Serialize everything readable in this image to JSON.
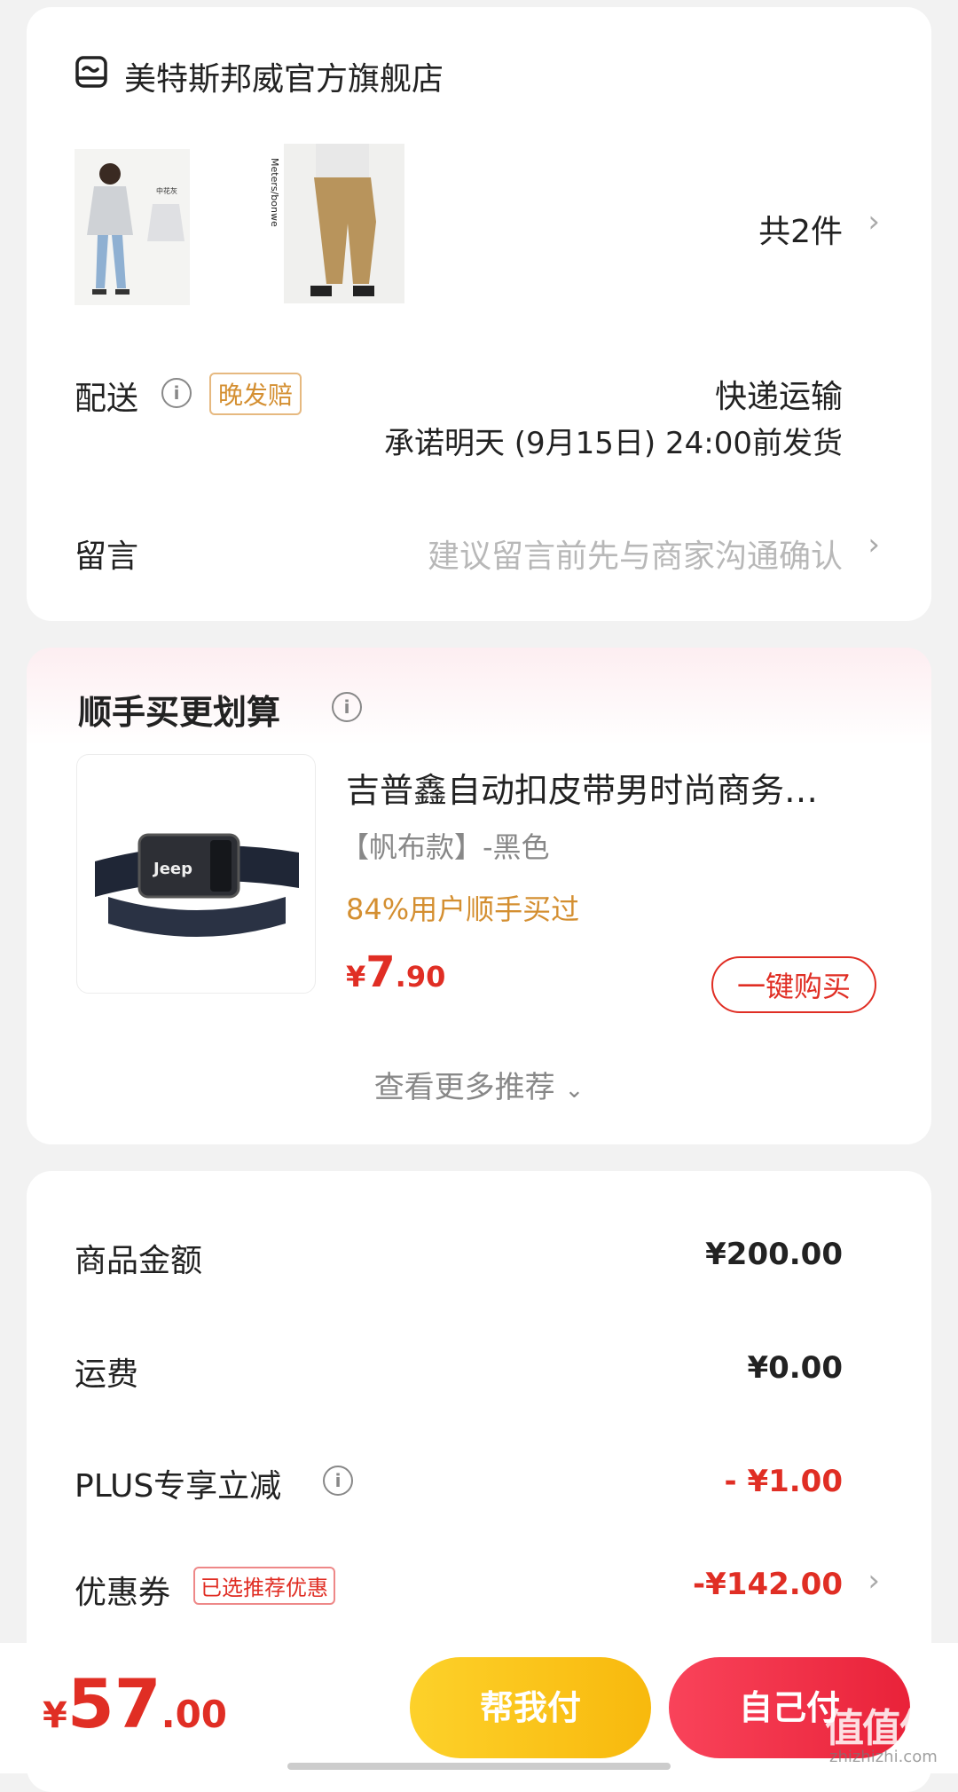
{
  "store": {
    "name": "美特斯邦威官方旗舰店",
    "icon": "store-icon"
  },
  "products": {
    "count_label": "共2件"
  },
  "delivery": {
    "label": "配送",
    "tag": "晚发赔",
    "method": "快递运输",
    "promise": "承诺明天 (9月15日) 24:00前发货"
  },
  "message": {
    "label": "留言",
    "placeholder": "建议留言前先与商家沟通确认"
  },
  "recommend": {
    "title": "顺手买更划算",
    "item": {
      "name": "吉普鑫自动扣皮带男时尚商务…",
      "variant": "【帆布款】-黑色",
      "stat": "84%用户顺手买过",
      "currency": "¥",
      "price_int": "7",
      "price_dec": ".90",
      "buy_label": "一键购买",
      "image_brand": "Jeep"
    },
    "more_label": "查看更多推荐"
  },
  "summary": {
    "rows": [
      {
        "label": "商品金额",
        "value": "¥200.00"
      },
      {
        "label": "运费",
        "value": "¥0.00"
      },
      {
        "label": "PLUS专享立减",
        "value": "- ¥1.00"
      },
      {
        "label": "优惠券",
        "tag": "已选推荐优惠",
        "value": "-¥142.00"
      }
    ]
  },
  "footer": {
    "currency": "¥",
    "total_int": "57",
    "total_dec": ".00",
    "help_pay_label": "帮我付",
    "self_pay_label": "自己付",
    "watermark": "值值值",
    "watermark_url": "zhizhizhi.com"
  },
  "colors": {
    "accent_red": "#e02e24",
    "accent_orange": "#d48f31",
    "help_pay": "#fcc51e",
    "self_pay": "#f2334a"
  }
}
